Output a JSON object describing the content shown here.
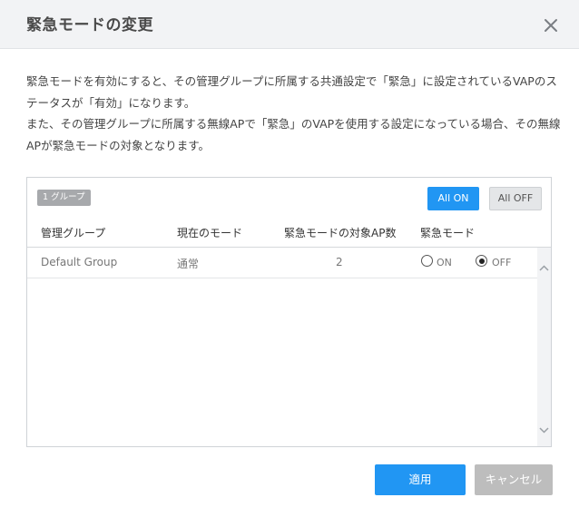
{
  "dialog": {
    "title": "緊急モードの変更"
  },
  "description": {
    "paragraph1": "緊急モードを有効にすると、その管理グループに所属する共通設定で「緊急」に設定されているVAPのステータスが「有効」になります。",
    "paragraph2": "また、その管理グループに所属する無線APで「緊急」のVAPを使用する設定になっている場合、その無線APが緊急モードの対象となります。"
  },
  "panel": {
    "group_badge": "1 グループ",
    "all_on_label": "All ON",
    "all_off_label": "All OFF",
    "columns": [
      "管理グループ",
      "現在のモード",
      "緊急モードの対象AP数",
      "緊急モード"
    ],
    "rows": [
      {
        "group": "Default Group",
        "mode": "通常",
        "ap_count": "2",
        "on_label": "ON",
        "off_label": "OFF",
        "selected": "OFF"
      }
    ]
  },
  "footer": {
    "apply_label": "適用",
    "cancel_label": "キャンセル"
  },
  "colors": {
    "primary": "#2196f3",
    "disabled": "#bdbdbd",
    "header_bg": "#f2f3f5"
  },
  "icons": {
    "close": "close-icon",
    "scroll_up": "chevron-up-icon",
    "scroll_down": "chevron-down-icon"
  }
}
